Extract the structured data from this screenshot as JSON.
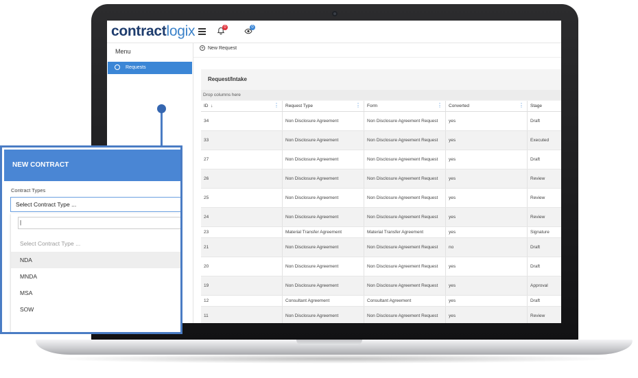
{
  "app": {
    "logo_part1": "contract",
    "logo_part2": "logix",
    "notification_count_red": "0",
    "notification_count_blue": "0"
  },
  "sidebar": {
    "title": "Menu",
    "items": [
      {
        "label": "Requests",
        "icon": "circle-plus-icon"
      }
    ]
  },
  "toolbar": {
    "new_request_label": "New Request"
  },
  "panel": {
    "title": "Request/Intake",
    "drop_hint": "Drop columns here"
  },
  "table": {
    "columns": [
      "ID",
      "Request Type",
      "Form",
      "Converted",
      "Stage"
    ],
    "sort_indicator": "↓",
    "rows": [
      [
        "34",
        "Non Disclosure Agreement",
        "Non Disclosure Agreement Request",
        "yes",
        "Draft"
      ],
      [
        "33",
        "Non Disclosure Agreement",
        "Non Disclosure Agreement Request",
        "yes",
        "Executed"
      ],
      [
        "27",
        "Non Disclosure Agreement",
        "Non Disclosure Agreement Request",
        "yes",
        "Draft"
      ],
      [
        "26",
        "Non Disclosure Agreement",
        "Non Disclosure Agreement Request",
        "yes",
        "Review"
      ],
      [
        "25",
        "Non Disclosure Agreement",
        "Non Disclosure Agreement Request",
        "yes",
        "Review"
      ],
      [
        "24",
        "Non Disclosure Agreement",
        "Non Disclosure Agreement Request",
        "yes",
        "Review"
      ],
      [
        "23",
        "Material Transfer Agreement",
        "Material Transfer Agreement",
        "yes",
        "Signature"
      ],
      [
        "21",
        "Non Disclosure Agreement",
        "Non Disclosure Agreement Request",
        "no",
        "Draft"
      ],
      [
        "20",
        "Non Disclosure Agreement",
        "Non Disclosure Agreement Request",
        "yes",
        "Draft"
      ],
      [
        "19",
        "Non Disclosure Agreement",
        "Non Disclosure Agreement Request",
        "yes",
        "Approval"
      ],
      [
        "12",
        "Consultant Agreement",
        "Consultant Agreement",
        "yes",
        "Draft"
      ],
      [
        "11",
        "Non Disclosure Agreement",
        "Non Disclosure Agreement Request",
        "yes",
        "Review"
      ]
    ]
  },
  "dialog": {
    "title": "NEW CONTRACT",
    "field_label": "Contract Types",
    "select_value": "Select Contract Type ...",
    "search_value": "|",
    "options": [
      "Select Contract Type ...",
      "NDA",
      "MNDA",
      "MSA",
      "SOW"
    ]
  },
  "colors": {
    "accent": "#3b86d6",
    "dialog_border": "#4a7cc4",
    "logo_dark": "#1f3d6e",
    "logo_light": "#3b82c9",
    "badge_red": "#e0303a",
    "badge_blue": "#3b86d6"
  }
}
